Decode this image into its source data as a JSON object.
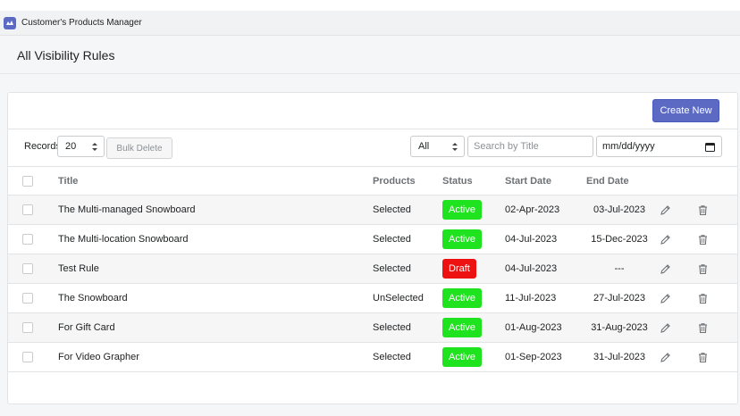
{
  "app": {
    "title": "Customer's Products Manager",
    "logo_icon": "app-logo-icon"
  },
  "page": {
    "title": "All Visibility Rules"
  },
  "toolbar": {
    "create_label": "Create New",
    "records_label": "Records",
    "records_value": "20",
    "bulk_delete_label": "Bulk Delete",
    "filter_value": "All",
    "search_placeholder": "Search by Title",
    "date_placeholder": "mm/dd/yyyy"
  },
  "table": {
    "columns": {
      "title": "Title",
      "products": "Products",
      "status": "Status",
      "start": "Start Date",
      "end": "End Date"
    },
    "rows": [
      {
        "title": "The Multi-managed Snowboard",
        "products": "Selected",
        "status": "Active",
        "start": "02-Apr-2023",
        "end": "03-Jul-2023"
      },
      {
        "title": "The Multi-location Snowboard",
        "products": "Selected",
        "status": "Active",
        "start": "04-Jul-2023",
        "end": "15-Dec-2023"
      },
      {
        "title": "Test Rule",
        "products": "Selected",
        "status": "Draft",
        "start": "04-Jul-2023",
        "end": "---"
      },
      {
        "title": "The Snowboard",
        "products": "UnSelected",
        "status": "Active",
        "start": "11-Jul-2023",
        "end": "27-Jul-2023"
      },
      {
        "title": "For Gift Card",
        "products": "Selected",
        "status": "Active",
        "start": "01-Aug-2023",
        "end": "31-Aug-2023"
      },
      {
        "title": "For Video Grapher",
        "products": "Selected",
        "status": "Active",
        "start": "01-Sep-2023",
        "end": "31-Jul-2023"
      }
    ]
  },
  "colors": {
    "accent": "#5c6ac4",
    "active": "#1ee31e",
    "draft": "#ee1111"
  },
  "icons": {
    "edit": "pencil-icon",
    "delete": "trash-icon",
    "calendar": "calendar-icon",
    "select": "up-down-arrows-icon"
  }
}
